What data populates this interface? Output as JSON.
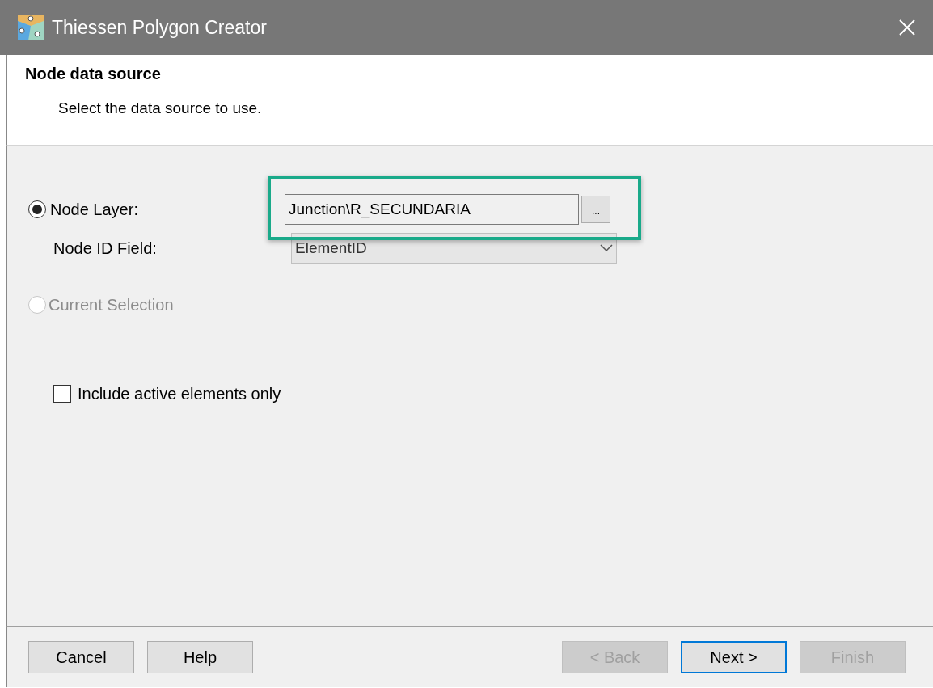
{
  "window": {
    "title": "Thiessen Polygon Creator"
  },
  "header": {
    "title": "Node data source",
    "subtitle": "Select the data source to use."
  },
  "source_options": [
    {
      "label": "Node Layer:",
      "selected": true,
      "disabled": false
    },
    {
      "label": "Current Selection",
      "selected": false,
      "disabled": true
    }
  ],
  "node_layer": {
    "value": "Junction\\R_SECUNDARIA",
    "browse_label": "..."
  },
  "node_id_field": {
    "label": "Node ID Field:",
    "value": "ElementID"
  },
  "include_active_only": {
    "label": "Include active elements only",
    "checked": false
  },
  "left_buttons": [
    {
      "label": "Cancel",
      "disabled": false,
      "default": false
    },
    {
      "label": "Help",
      "disabled": false,
      "default": false
    }
  ],
  "right_buttons": [
    {
      "label": "< Back",
      "disabled": true,
      "default": false
    },
    {
      "label": "Next >",
      "disabled": false,
      "default": true
    },
    {
      "label": "Finish",
      "disabled": true,
      "default": false
    }
  ]
}
